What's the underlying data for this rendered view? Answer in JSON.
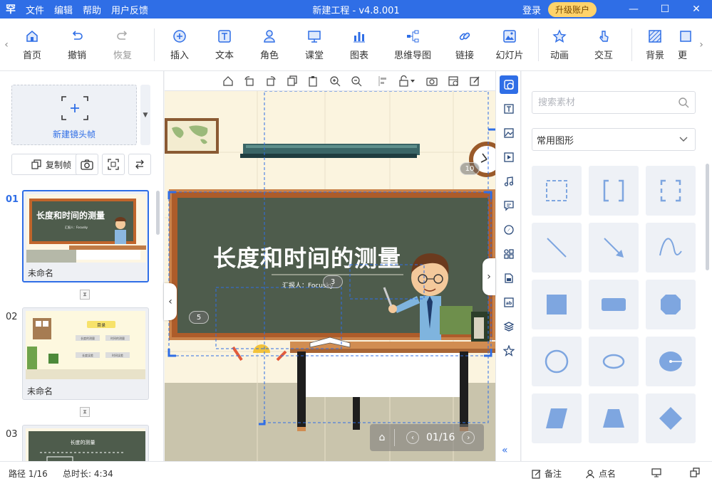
{
  "titlebar": {
    "logo": "罕",
    "menu": [
      "文件",
      "编辑",
      "帮助",
      "用户反馈"
    ],
    "title": "新建工程 - v4.8.001",
    "login": "登录",
    "upgrade": "升级账户"
  },
  "ribbon": {
    "tools": [
      {
        "label": "首页",
        "icon": "home-icon"
      },
      {
        "label": "撤销",
        "icon": "undo-icon"
      },
      {
        "label": "恢复",
        "icon": "redo-icon"
      },
      {
        "label": "插入",
        "icon": "plus-circle-icon"
      },
      {
        "label": "文本",
        "icon": "text-icon"
      },
      {
        "label": "角色",
        "icon": "character-icon"
      },
      {
        "label": "课堂",
        "icon": "classroom-icon"
      },
      {
        "label": "图表",
        "icon": "chart-icon"
      },
      {
        "label": "思维导图",
        "icon": "mindmap-icon"
      },
      {
        "label": "链接",
        "icon": "link-icon"
      },
      {
        "label": "幻灯片",
        "icon": "slide-icon"
      },
      {
        "label": "动画",
        "icon": "animation-icon"
      },
      {
        "label": "交互",
        "icon": "interact-icon"
      },
      {
        "label": "背景",
        "icon": "background-icon"
      },
      {
        "label": "更",
        "icon": "more-icon"
      }
    ]
  },
  "left": {
    "new_frame": "新建镜头帧",
    "copy_frame": "复制帧",
    "slides": [
      {
        "num": "01",
        "name": "未命名"
      },
      {
        "num": "02",
        "name": "未命名"
      },
      {
        "num": "03",
        "name": ""
      }
    ],
    "thumb1": {
      "title": "长度和时间的测量",
      "presenter": "汇报人：Focusky"
    },
    "thumb2": {
      "title": "目录",
      "items": [
        "长度的测量",
        "时间的测量",
        "长度误差",
        "时间误差"
      ]
    },
    "thumb3": {
      "title": "长度的测量"
    }
  },
  "canvas": {
    "title": "长度和时间的测量",
    "presenter": "汇报人：Focusky",
    "badges": [
      "10",
      "3",
      "5"
    ],
    "pager": "01/16"
  },
  "material": {
    "search_placeholder": "搜索素材",
    "category": "常用图形",
    "shapes": [
      "dashed-square-shape",
      "bracket-shape",
      "corner-bracket-shape",
      "line-shape",
      "arrow-line-shape",
      "curve-shape",
      "square-shape",
      "rounded-rect-shape",
      "octagon-shape",
      "circle-shape",
      "ellipse-shape",
      "pie-shape",
      "parallelogram-shape",
      "trapezoid-shape",
      "diamond-shape"
    ]
  },
  "status": {
    "path": "路径 1/16",
    "duration": "总时长: 4:34",
    "notes": "备注",
    "rollcall": "点名"
  },
  "colors": {
    "accent": "#2f6ee6",
    "chalkboard": "#4e5c4c",
    "board_frame": "#c0652b",
    "shape_fill": "#7ea6e0"
  }
}
